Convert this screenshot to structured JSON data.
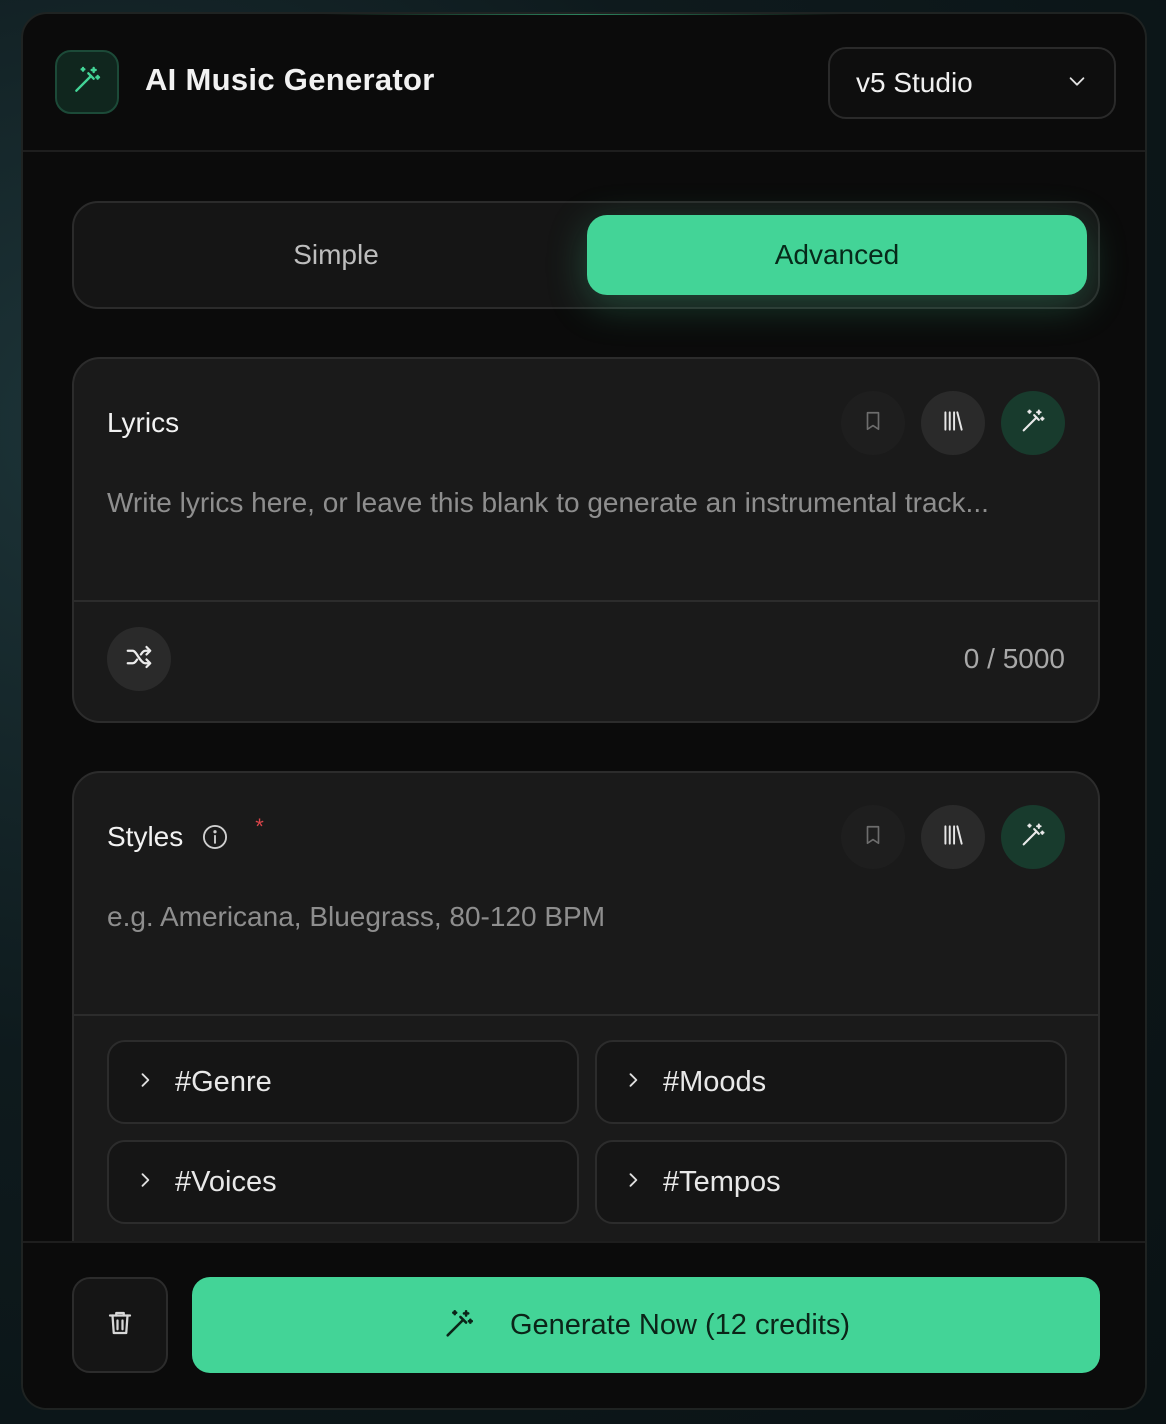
{
  "app": {
    "title": "AI Music Generator",
    "logo_icon": "magic-wand-icon",
    "accent_color": "#43d497"
  },
  "model_select": {
    "value": "v5 Studio",
    "icon": "chevron-down-icon"
  },
  "mode_tabs": [
    {
      "label": "Simple",
      "active": false
    },
    {
      "label": "Advanced",
      "active": true
    }
  ],
  "lyrics": {
    "title": "Lyrics",
    "placeholder": "Write lyrics here, or leave this blank to generate an instrumental track...",
    "value": "",
    "char_count": "0 / 5000",
    "actions": [
      "bookmark-icon",
      "library-icon",
      "magic-wand-icon"
    ],
    "shuffle_icon": "shuffle-icon"
  },
  "styles": {
    "title": "Styles",
    "required_mark": "*",
    "info_icon": "info-icon",
    "placeholder": "e.g. Americana, Bluegrass, 80-120 BPM",
    "value": "",
    "actions": [
      "bookmark-icon",
      "library-icon",
      "magic-wand-icon"
    ],
    "categories": [
      "#Genre",
      "#Moods",
      "#Voices",
      "#Tempos"
    ]
  },
  "footer": {
    "delete_icon": "trash-icon",
    "generate_label": "Generate Now (12 credits)",
    "generate_icon": "magic-wand-icon"
  }
}
